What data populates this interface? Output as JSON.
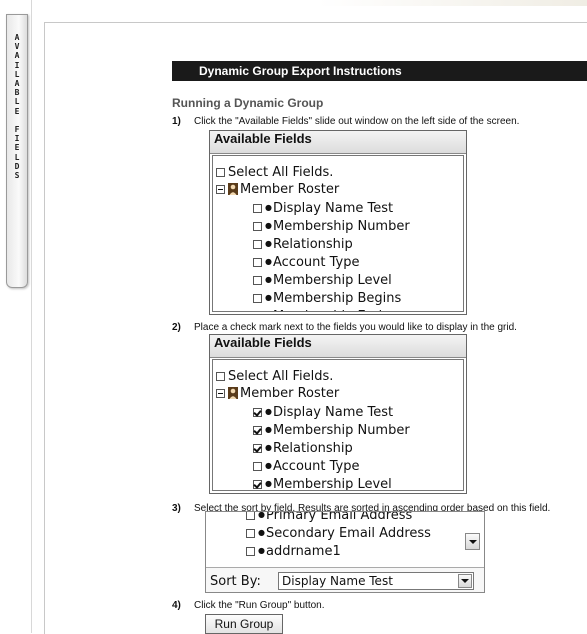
{
  "sidebar": {
    "tab_label": "AVAILABLE FIELDS"
  },
  "header": {
    "title": "Dynamic Group Export Instructions"
  },
  "section": {
    "title": "Running a Dynamic Group"
  },
  "steps": [
    {
      "num": "1)",
      "text": "Click the \"Available Fields\" slide out window on the left side of the screen."
    },
    {
      "num": "2)",
      "text": "Place a check mark next to the fields you would like to display in the grid."
    },
    {
      "num": "3)",
      "text": "Select the sort by field. Results are sorted in ascending order based on this field."
    },
    {
      "num": "4)",
      "text": "Click the \"Run Group\" button."
    }
  ],
  "fields_box_1": {
    "title": "Available Fields",
    "select_all": "Select All Fields.",
    "group": "Member Roster",
    "items": [
      {
        "label": "Display Name Test",
        "checked": false
      },
      {
        "label": "Membership Number",
        "checked": false
      },
      {
        "label": "Relationship",
        "checked": false
      },
      {
        "label": "Account Type",
        "checked": false
      },
      {
        "label": "Membership Level",
        "checked": false
      },
      {
        "label": "Membership Begins",
        "checked": false
      },
      {
        "label": "Membership Ends",
        "checked": false
      }
    ]
  },
  "fields_box_2": {
    "title": "Available Fields",
    "select_all": "Select All Fields.",
    "group": "Member Roster",
    "items": [
      {
        "label": "Display Name Test",
        "checked": true
      },
      {
        "label": "Membership Number",
        "checked": true
      },
      {
        "label": "Relationship",
        "checked": true
      },
      {
        "label": "Account Type",
        "checked": false
      },
      {
        "label": "Membership Level",
        "checked": true
      }
    ]
  },
  "sort_box": {
    "items": [
      "Primary Email Address",
      "Secondary Email Address",
      "addrname1"
    ],
    "sort_label": "Sort By:",
    "sort_value": "Display Name Test"
  },
  "run_button": {
    "label": "Run Group"
  }
}
